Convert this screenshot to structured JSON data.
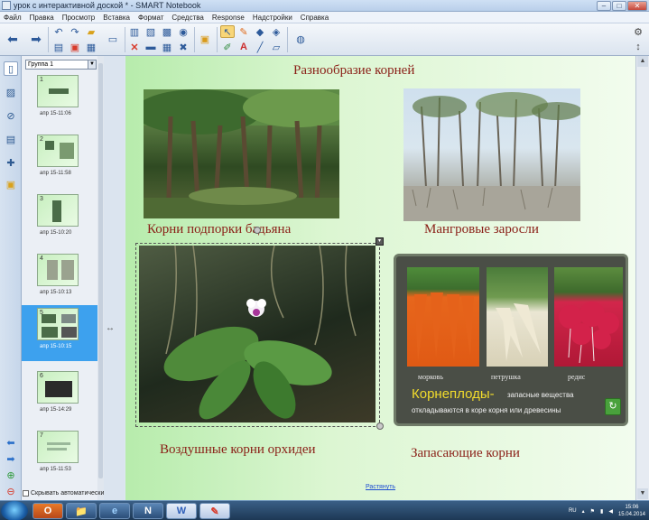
{
  "window": {
    "title": "урок с интерактивной доской * - SMART Notebook",
    "controls": [
      "–",
      "□",
      "✕"
    ]
  },
  "menu": [
    "Файл",
    "Правка",
    "Просмотр",
    "Вставка",
    "Формат",
    "Средства",
    "Response",
    "Надстройки",
    "Справка"
  ],
  "sorter": {
    "group": "Группа 1",
    "pages": [
      {
        "num": "1",
        "label": "апр 15-11:06"
      },
      {
        "num": "2",
        "label": "апр 15-11:58"
      },
      {
        "num": "3",
        "label": "апр 15-10:20"
      },
      {
        "num": "4",
        "label": "апр 15-10:13"
      },
      {
        "num": "5",
        "label": "апр 15-10:15"
      },
      {
        "num": "6",
        "label": "апр 15-14:29"
      },
      {
        "num": "7",
        "label": "апр 15-11:53"
      }
    ],
    "autohide_label": "Скрывать автоматически"
  },
  "slide": {
    "title": "Разнообразие корней",
    "captions": {
      "banyan": "Корни подпорки бадьяна",
      "mangrove": "Мангровые заросли",
      "orchid": "Воздушные корни орхидеи",
      "storage": "Запасающие корни"
    },
    "panel": {
      "vegetables": [
        "морковь",
        "петрушка",
        "редис"
      ],
      "heading": "Корнеплоды-",
      "text1": "запасные вещества",
      "text2": "откладываются в коре корня или древесины"
    },
    "grow_link": "Растянуть"
  },
  "taskbar": {
    "apps": [
      "O",
      "📁",
      "e",
      "N",
      "W",
      "✎"
    ],
    "lang": "RU",
    "time": "15:06",
    "date": "15.04.2014"
  }
}
